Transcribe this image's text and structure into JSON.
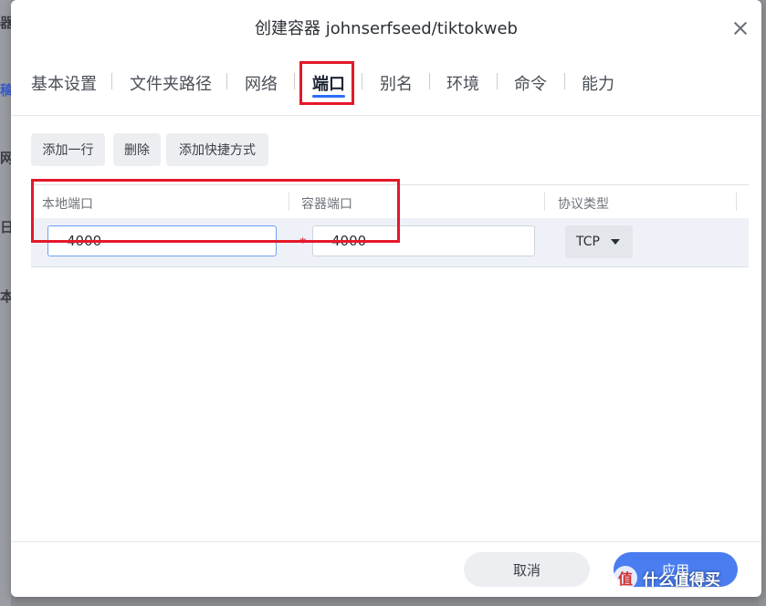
{
  "background": {
    "left_chars": [
      "器",
      "稿",
      "网",
      "日",
      "本"
    ]
  },
  "dialog": {
    "title": "创建容器 johnserfseed/tiktokweb"
  },
  "tabs": [
    {
      "label": "基本设置",
      "active": false
    },
    {
      "label": "文件夹路径",
      "active": false
    },
    {
      "label": "网络",
      "active": false
    },
    {
      "label": "端口",
      "active": true
    },
    {
      "label": "别名",
      "active": false
    },
    {
      "label": "环境",
      "active": false
    },
    {
      "label": "命令",
      "active": false
    },
    {
      "label": "能力",
      "active": false
    }
  ],
  "toolbar": {
    "add_row": "添加一行",
    "delete": "删除",
    "add_shortcut": "添加快捷方式"
  },
  "ports_table": {
    "columns": [
      "本地端口",
      "容器端口",
      "协议类型"
    ],
    "rows": [
      {
        "local_port": "4000",
        "container_port": "4000",
        "required_mark": "*",
        "protocol": "TCP"
      }
    ]
  },
  "footer": {
    "cancel": "取消",
    "apply": "应用"
  },
  "watermark": {
    "logo": "值",
    "text": "什么值得买"
  },
  "colors": {
    "accent": "#2d6df6",
    "highlight_box": "#e4182a",
    "apply_button": "#4a7ef0"
  }
}
